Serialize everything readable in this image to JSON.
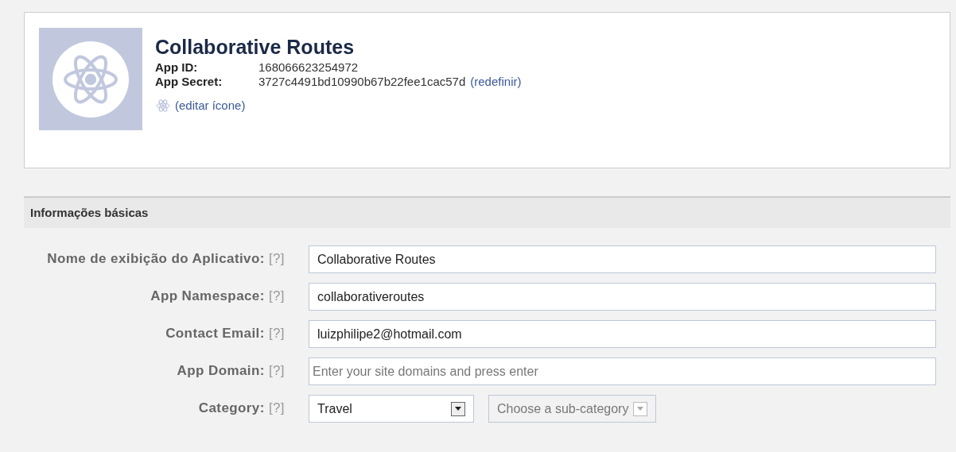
{
  "app": {
    "title": "Collaborative Routes",
    "id_label": "App ID:",
    "id_value": "168066623254972",
    "secret_label": "App Secret:",
    "secret_value": "3727c4491bd10990b67b22fee1cac57d",
    "reset_link": "(redefinir)",
    "edit_icon_link": "(editar ícone)"
  },
  "section": {
    "title": "Informações básicas"
  },
  "fields": [
    {
      "kind": "text",
      "label": "Nome de exibição do Aplicativo:",
      "help": "[?]",
      "value": "Collaborative Routes"
    },
    {
      "kind": "text",
      "label": "App Namespace:",
      "help": "[?]",
      "value": "collaborativeroutes"
    },
    {
      "kind": "text",
      "label": "Contact Email:",
      "help": "[?]",
      "value": "luizphilipe2@hotmail.com"
    },
    {
      "kind": "text",
      "label": "App Domain:",
      "help": "[?]",
      "placeholder": "Enter your site domains and press enter"
    },
    {
      "kind": "select",
      "label": "Category:",
      "help": "[?]",
      "value": "Travel",
      "sub_select": {
        "placeholder": "Choose a sub-category",
        "disabled": true
      }
    }
  ]
}
